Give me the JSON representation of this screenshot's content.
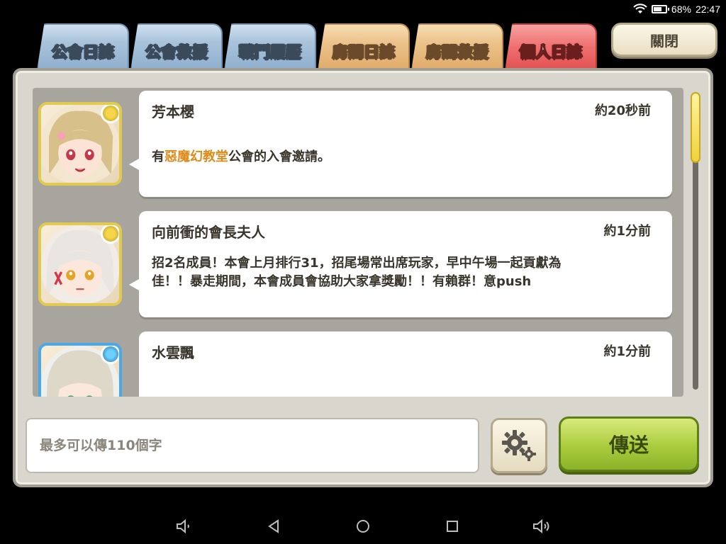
{
  "status_bar": {
    "battery": "68%",
    "time": "22:47",
    "battery_level": 0.68
  },
  "tabs": [
    {
      "label": "公會日誌",
      "color": "blue",
      "active": false
    },
    {
      "label": "公會救援",
      "color": "blue",
      "active": false
    },
    {
      "label": "戰鬥履歷",
      "color": "blue",
      "active": false
    },
    {
      "label": "房間日誌",
      "color": "orange",
      "active": false
    },
    {
      "label": "房間救援",
      "color": "orange",
      "active": false
    },
    {
      "label": "個人日誌",
      "color": "red",
      "active": true
    }
  ],
  "close_label": "關閉",
  "messages": [
    {
      "name": "芳本櫻",
      "time": "約20秒前",
      "body_prefix": "有",
      "body_highlight": "惡魔幻教堂",
      "body_suffix": "公會的入會邀請。",
      "frame": "gold"
    },
    {
      "name": "向前衝的會長夫人",
      "time": "約1分前",
      "body": "招2名成員！本會上月排行31，招尾場常出席玩家，早中午場一起貢獻為佳！！暴走期間，本會成員會協助大家拿獎勵！！有賴群！意push",
      "frame": "gold"
    },
    {
      "name": "水雲飄",
      "time": "約1分前",
      "body": "",
      "frame": "blue"
    }
  ],
  "input": {
    "placeholder": "最多可以傳110個字"
  },
  "send_label": "傳送",
  "colors": {
    "highlight": "#e08a1a",
    "send_button": "#a9cc3d",
    "active_tab": "#ef7070"
  }
}
